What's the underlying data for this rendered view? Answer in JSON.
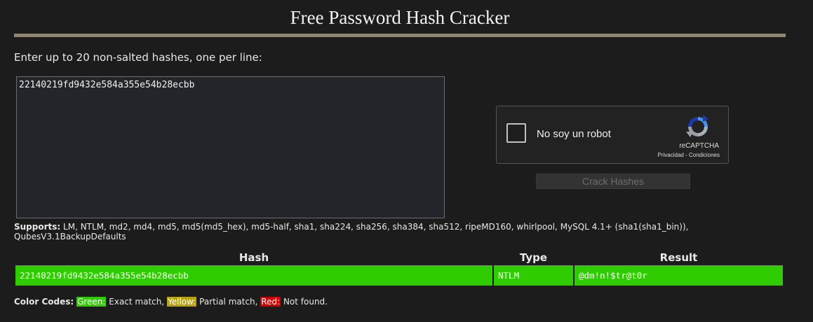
{
  "page": {
    "title": "Free Password Hash Cracker",
    "instructions": "Enter up to 20 non-salted hashes, one per line:",
    "colors": {
      "accent_bar": "#8f8575",
      "match_green": "#2ecc00",
      "partial_yellow": "#b8a40a",
      "notfound_red": "#d40000"
    }
  },
  "form": {
    "hashes_value": "22140219fd9432e584a355e54b28ecbb",
    "crack_button": "Crack Hashes"
  },
  "recaptcha": {
    "label": "No soy un robot",
    "brand": "reCAPTCHA",
    "links": "Privacidad - Condiciones",
    "icon": "recaptcha-logo-icon"
  },
  "supports": {
    "label": "Supports:",
    "text": " LM, NTLM, md2, md4, md5, md5(md5_hex), md5-half, sha1, sha224, sha256, sha384, sha512, ripeMD160, whirlpool, MySQL 4.1+ (sha1(sha1_bin)), QubesV3.1BackupDefaults"
  },
  "results": {
    "headers": {
      "hash": "Hash",
      "type": "Type",
      "result": "Result"
    },
    "rows": [
      {
        "hash": "22140219fd9432e584a355e54b28ecbb",
        "type": "NTLM",
        "result": "@dm!n!$tr@t0r",
        "status": "green"
      }
    ]
  },
  "color_codes": {
    "label": "Color Codes:",
    "green": "Green:",
    "green_desc": " Exact match, ",
    "yellow": "Yellow:",
    "yellow_desc": " Partial match, ",
    "red": "Red:",
    "red_desc": " Not found."
  }
}
